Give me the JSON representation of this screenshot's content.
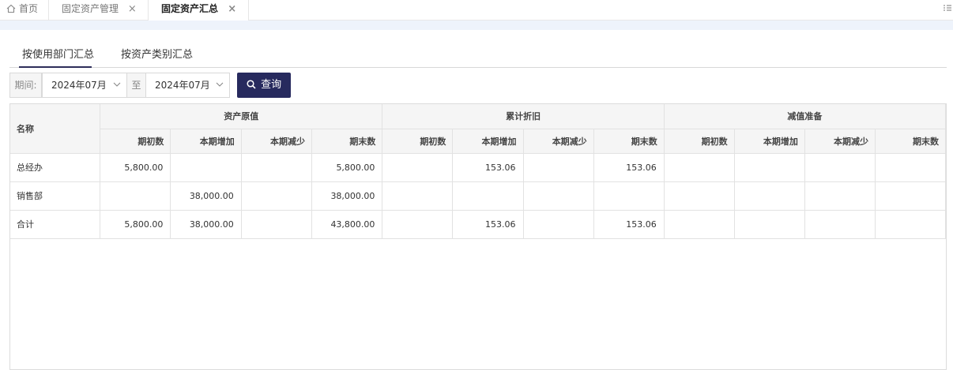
{
  "tabs": {
    "home": "首页",
    "management": "固定资产管理",
    "summary": "固定资产汇总",
    "close": "×"
  },
  "subtabs": {
    "by_department": "按使用部门汇总",
    "by_category": "按资产类别汇总"
  },
  "filter": {
    "period_label": "期间:",
    "from": "2024年07月",
    "to_label": "至",
    "to": "2024年07月",
    "query_button": "查询"
  },
  "table": {
    "name_header": "名称",
    "groups": [
      "资产原值",
      "累计折旧",
      "减值准备"
    ],
    "sub_headers": [
      "期初数",
      "本期增加",
      "本期减少",
      "期末数"
    ],
    "rows": [
      {
        "name": "总经办",
        "cells": [
          "5,800.00",
          "",
          "",
          "5,800.00",
          "",
          "153.06",
          "",
          "153.06",
          "",
          "",
          "",
          ""
        ]
      },
      {
        "name": "销售部",
        "cells": [
          "",
          "38,000.00",
          "",
          "38,000.00",
          "",
          "",
          "",
          "",
          "",
          "",
          "",
          ""
        ]
      },
      {
        "name": "合计",
        "cells": [
          "5,800.00",
          "38,000.00",
          "",
          "43,800.00",
          "",
          "153.06",
          "",
          "153.06",
          "",
          "",
          "",
          ""
        ]
      }
    ]
  },
  "colors": {
    "accent": "#272a5e",
    "header_bg": "#f5f5f5",
    "band_bg": "#eef3fb"
  }
}
